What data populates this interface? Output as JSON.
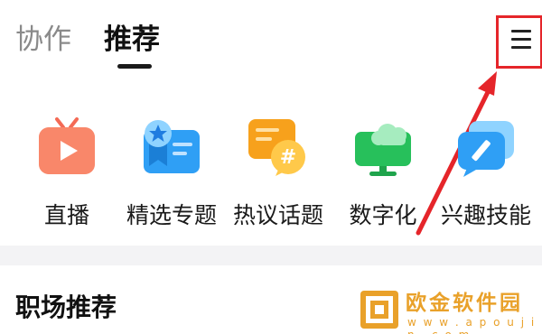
{
  "tabs": [
    {
      "label": "协作",
      "active": false
    },
    {
      "label": "推荐",
      "active": true
    }
  ],
  "header": {
    "menu_icon": "hamburger-menu-icon"
  },
  "shortcuts": [
    {
      "label": "直播",
      "icon": "tv-play-icon",
      "color": "#f46a55"
    },
    {
      "label": "精选专题",
      "icon": "star-badge-card-icon",
      "color": "#2f9ff5"
    },
    {
      "label": "热议话题",
      "icon": "chat-hashtag-icon",
      "color": "#f7a11c"
    },
    {
      "label": "数字化",
      "icon": "cloud-monitor-icon",
      "color": "#27c05b"
    },
    {
      "label": "兴趣技能",
      "icon": "chat-pen-icon",
      "color": "#2f9ff5"
    }
  ],
  "section": {
    "title": "职场推荐"
  },
  "watermark": {
    "name": "欧金软件园",
    "domain": "w w w . a p o u j i n . c o m"
  },
  "colors": {
    "annotation": "#e5252a",
    "watermark": "#e9a12a"
  }
}
